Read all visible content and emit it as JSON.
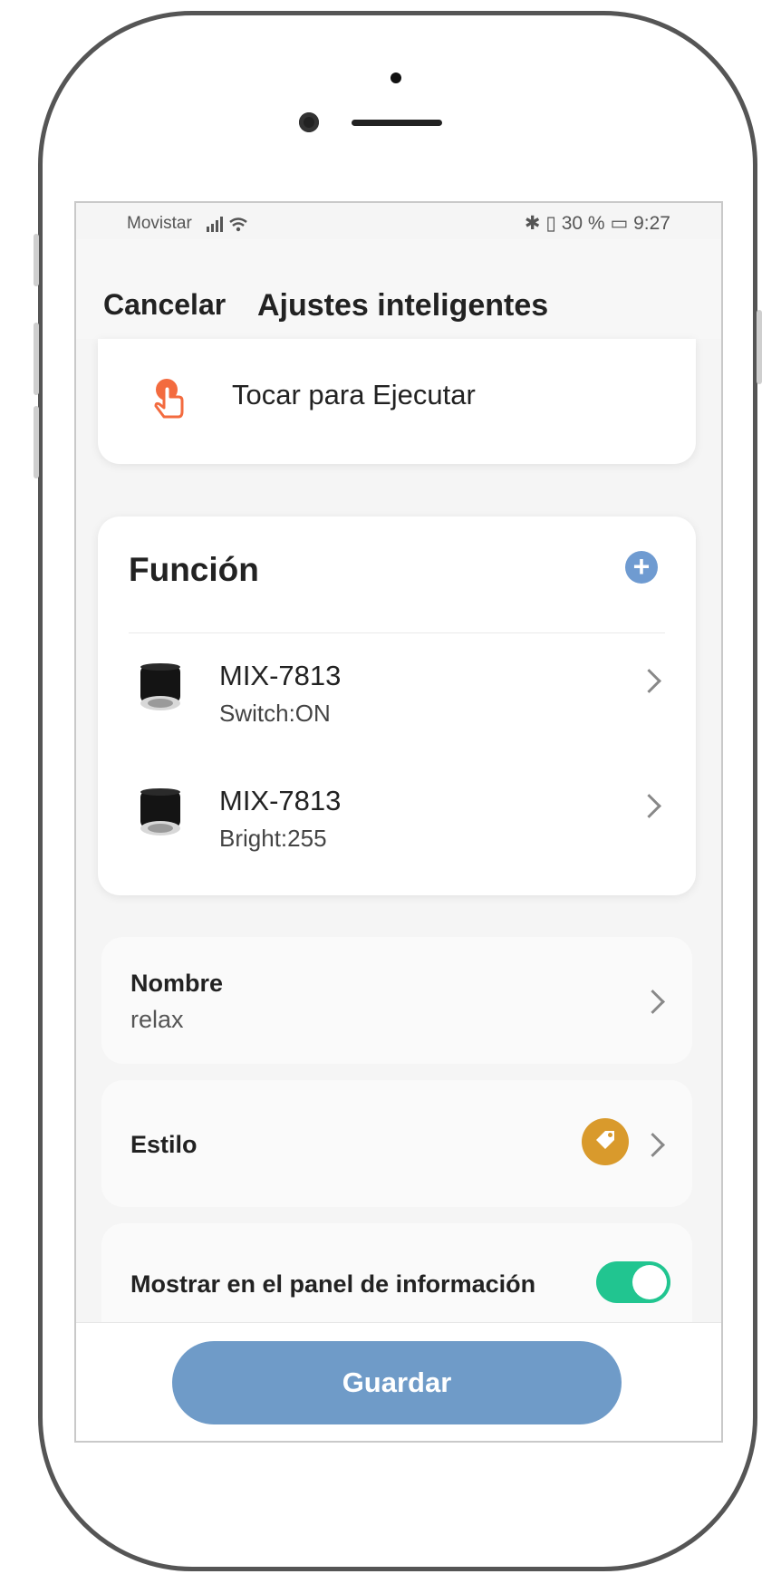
{
  "status_bar": {
    "carrier": "Movistar",
    "signal_icon": "signal-bars-icon",
    "wifi_icon": "wifi-icon",
    "right_text": "✱ ▯ 30 % ▭ 9:27",
    "battery": "30 %",
    "time": "9:27"
  },
  "header": {
    "cancel_label": "Cancelar",
    "title": "Ajustes inteligentes"
  },
  "execute": {
    "icon": "tap-hand-icon",
    "label": "Tocar para Ejecutar"
  },
  "function": {
    "title": "Función",
    "add_icon": "plus-icon",
    "devices": [
      {
        "name": "MIX-7813",
        "detail": "Switch:ON"
      },
      {
        "name": "MIX-7813",
        "detail": "Bright:255"
      }
    ]
  },
  "name_setting": {
    "label": "Nombre",
    "value": "relax"
  },
  "style_setting": {
    "label": "Estilo",
    "icon": "tag-icon",
    "color": "#d99a2c"
  },
  "info_panel": {
    "label": "Mostrar en el panel de información",
    "enabled": true,
    "toggle_color": "#21c590"
  },
  "footer": {
    "save_label": "Guardar",
    "button_color": "#6f9bc8"
  }
}
